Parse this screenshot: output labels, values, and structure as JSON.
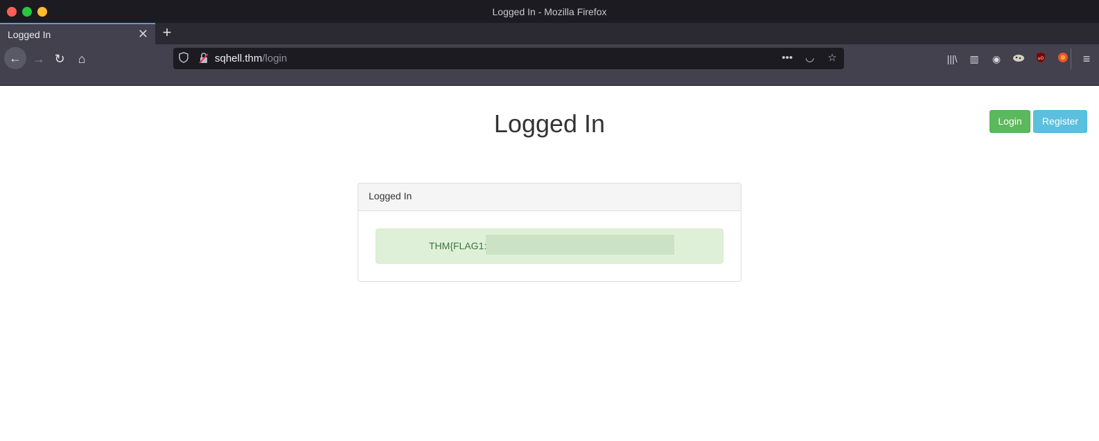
{
  "window": {
    "title": "Logged In - Mozilla Firefox"
  },
  "tab": {
    "label": "Logged In",
    "close": "✕",
    "new": "+"
  },
  "url": {
    "host": "sqhell.thm",
    "path": "/login"
  },
  "nav": {
    "back": "←",
    "forward": "→",
    "reload": "↻",
    "home": "⌂"
  },
  "url_actions": {
    "more": "•••",
    "pocket": "◡",
    "bookmark": "☆"
  },
  "toolbar": {
    "library": "|||\\",
    "sidebar": "▥",
    "account": "◉",
    "menu": "≡"
  },
  "page": {
    "heading": "Logged In",
    "login_button": "Login",
    "register_button": "Register",
    "panel_title": "Logged In",
    "flag_prefix": "THM{FLAG1:"
  },
  "colors": {
    "success": "#5cb85c",
    "info": "#5bc0de",
    "alert_bg": "#dff0d8",
    "alert_text": "#3c763d"
  }
}
